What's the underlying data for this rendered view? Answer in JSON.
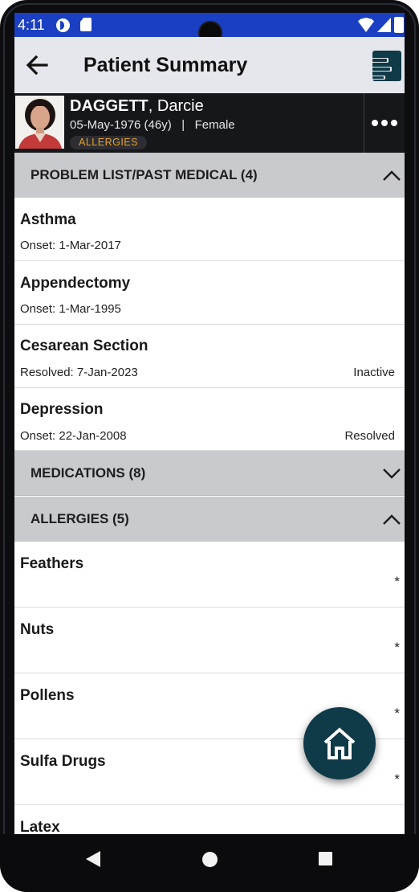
{
  "status_bar": {
    "time": "4:11",
    "icons": [
      "data-saver-icon",
      "sim-card-icon",
      "wifi-icon",
      "signal-icon",
      "battery-icon"
    ]
  },
  "app_bar": {
    "title": "Patient Summary",
    "back_icon": "arrow-left-icon",
    "action_icon": "document-list-icon"
  },
  "patient": {
    "last_name": "DAGGETT",
    "first_name": ", Darcie",
    "meta": "05-May-1976 (46y)   |   Female",
    "badge": "ALLERGIES",
    "more_icon": "more-horizontal-icon"
  },
  "sections": {
    "problems": {
      "title": "PROBLEM LIST/PAST MEDICAL (4)",
      "expanded": true,
      "items": [
        {
          "name": "Asthma",
          "date": "Onset: 1-Mar-2017",
          "status": ""
        },
        {
          "name": "Appendectomy",
          "date": "Onset: 1-Mar-1995",
          "status": ""
        },
        {
          "name": "Cesarean Section",
          "date": "Resolved: 7-Jan-2023",
          "status": "Inactive"
        },
        {
          "name": "Depression",
          "date": "Onset: 22-Jan-2008",
          "status": "Resolved"
        }
      ]
    },
    "medications": {
      "title": "MEDICATIONS (8)",
      "expanded": false
    },
    "allergies": {
      "title": "ALLERGIES (5)",
      "expanded": true,
      "items": [
        {
          "name": "Feathers",
          "mark": "*"
        },
        {
          "name": "Nuts",
          "mark": "*"
        },
        {
          "name": "Pollens",
          "mark": "*"
        },
        {
          "name": "Sulfa Drugs",
          "mark": "*"
        },
        {
          "name": "Latex",
          "mark": ""
        }
      ]
    }
  },
  "fab": {
    "icon": "home-icon"
  },
  "nav_bar": {
    "icons": [
      "nav-back-icon",
      "nav-home-icon",
      "nav-recents-icon"
    ]
  },
  "colors": {
    "status_bar": "#1a3fc2",
    "app_bar": "#e6e7ec",
    "banner": "#16171a",
    "section_header": "#c9cacd",
    "allergy_badge_text": "#e6a22c",
    "fab": "#0f3a47"
  }
}
